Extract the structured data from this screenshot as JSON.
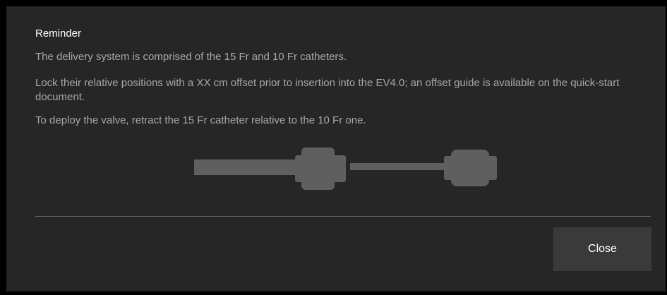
{
  "dialog": {
    "title": "Reminder",
    "paragraphs": [
      "The delivery system is comprised of the 15 Fr and 10 Fr catheters.",
      "Lock their relative positions with a XX cm offset prior to insertion into the EV4.0; an offset guide is available on the quick-start document.",
      "To deploy the valve, retract the 15 Fr catheter relative to the 10 Fr one."
    ],
    "illustration_icon": "catheter-assembly-icon",
    "close_label": "Close"
  },
  "colors": {
    "background": "#262626",
    "title_text": "#ffffff",
    "body_text": "#a8a8a8",
    "button_bg": "#3a3a3a",
    "divider": "#6a6a6a",
    "illustration": "#5f5f5f"
  }
}
